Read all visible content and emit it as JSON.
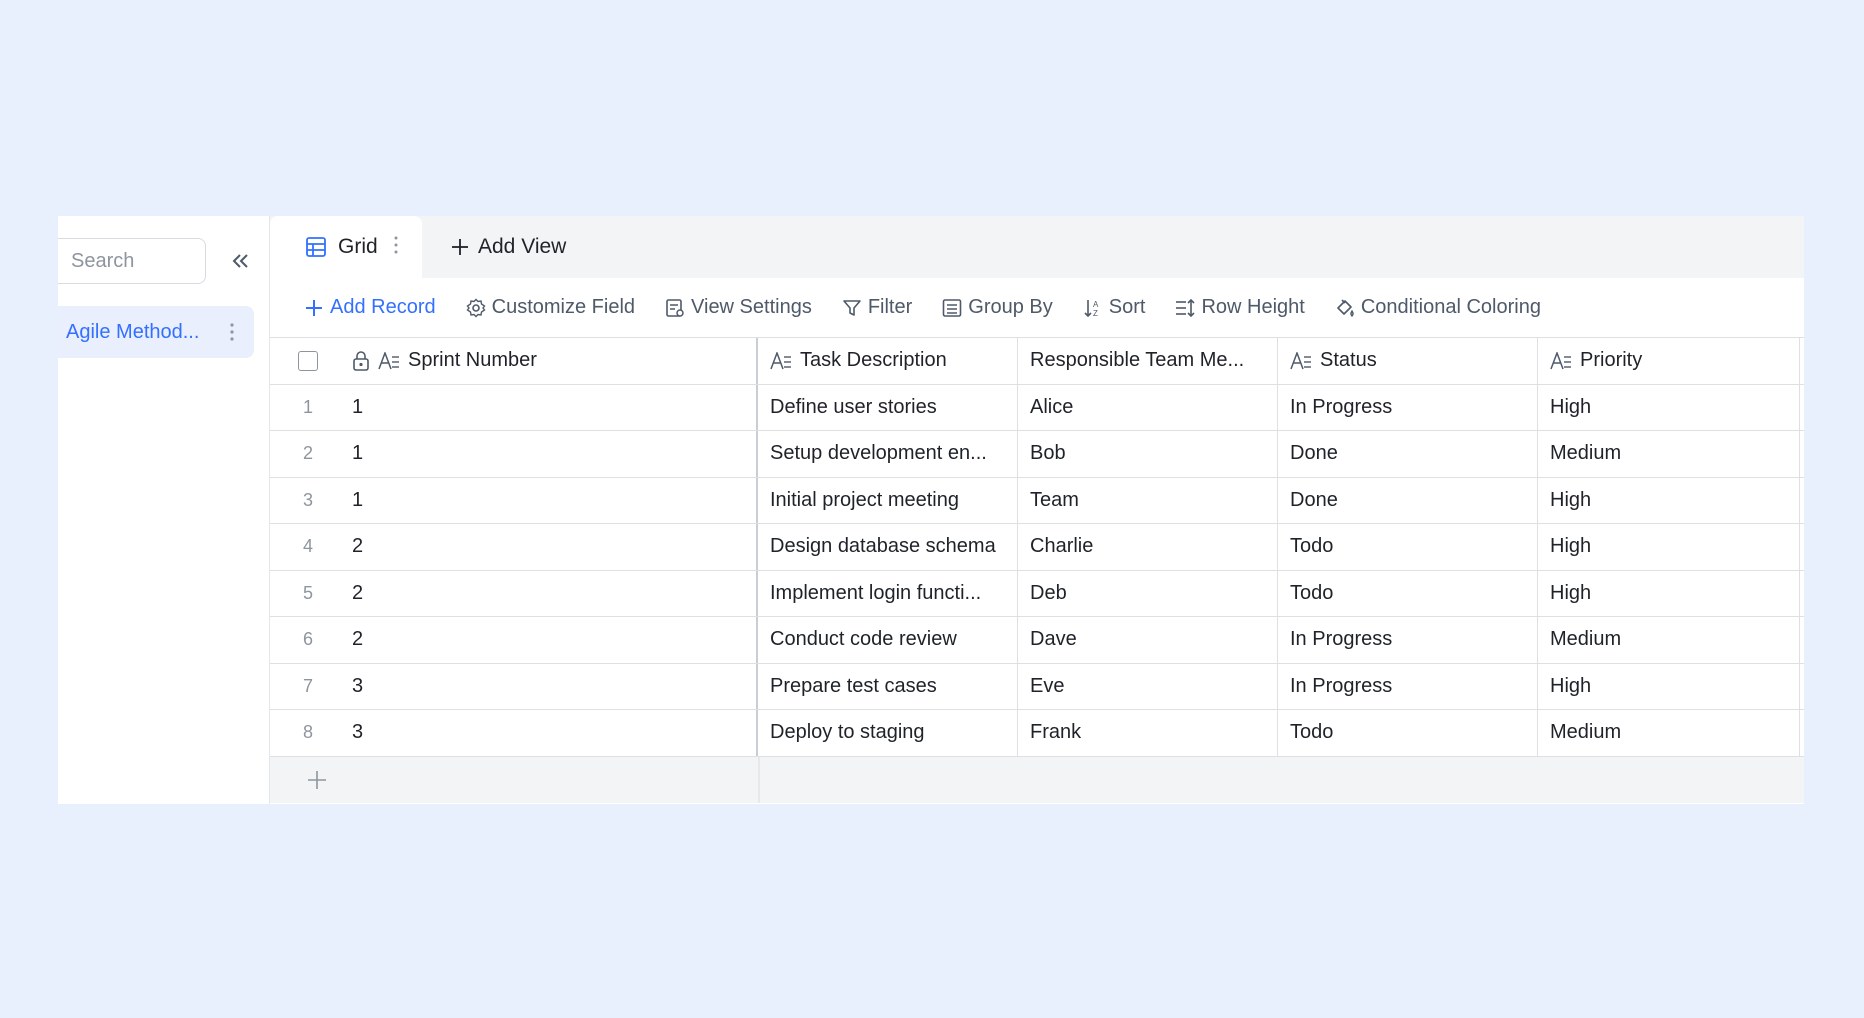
{
  "sidebar": {
    "search_placeholder": "Search",
    "tables": [
      {
        "label": "Agile Method..."
      }
    ]
  },
  "tabs": {
    "active": "Grid",
    "add_view_label": "Add View"
  },
  "toolbar": {
    "add_record": "Add Record",
    "customize_field": "Customize Field",
    "view_settings": "View Settings",
    "filter": "Filter",
    "group_by": "Group By",
    "sort": "Sort",
    "row_height": "Row Height",
    "conditional_coloring": "Conditional Coloring"
  },
  "grid": {
    "columns": [
      "Sprint Number",
      "Task Description",
      "Responsible Team Me...",
      "Status",
      "Priority"
    ],
    "rows": [
      {
        "index": "1",
        "sprint": "1",
        "task": "Define user stories",
        "member": "Alice",
        "status": "In Progress",
        "priority": "High"
      },
      {
        "index": "2",
        "sprint": "1",
        "task": "Setup development en...",
        "member": "Bob",
        "status": "Done",
        "priority": "Medium"
      },
      {
        "index": "3",
        "sprint": "1",
        "task": "Initial project meeting",
        "member": "Team",
        "status": "Done",
        "priority": "High"
      },
      {
        "index": "4",
        "sprint": "2",
        "task": "Design database schema",
        "member": "Charlie",
        "status": "Todo",
        "priority": "High"
      },
      {
        "index": "5",
        "sprint": "2",
        "task": "Implement login functi...",
        "member": "Deb",
        "status": "Todo",
        "priority": "High"
      },
      {
        "index": "6",
        "sprint": "2",
        "task": "Conduct code review",
        "member": "Dave",
        "status": "In Progress",
        "priority": "Medium"
      },
      {
        "index": "7",
        "sprint": "3",
        "task": "Prepare test cases",
        "member": "Eve",
        "status": "In Progress",
        "priority": "High"
      },
      {
        "index": "8",
        "sprint": "3",
        "task": "Deploy to staging",
        "member": "Frank",
        "status": "Todo",
        "priority": "Medium"
      }
    ]
  },
  "colors": {
    "background": "#e8effd",
    "accent": "#3370ff",
    "text": "#1f2329",
    "muted": "#8f959e",
    "border": "#dee0e3"
  }
}
